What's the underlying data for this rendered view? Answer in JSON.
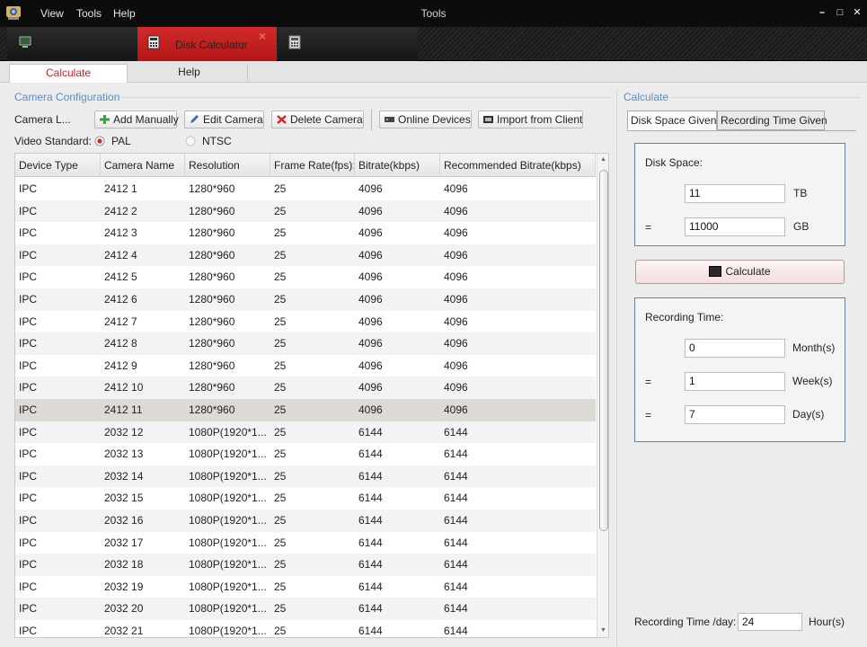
{
  "titlebar": {
    "menus": [
      "View",
      "Tools",
      "Help"
    ],
    "title": "Tools"
  },
  "modules": {
    "control_panel": "Control Panel",
    "disk_calculator": "Disk Calculator",
    "calculation_tool": "Calculation Tool"
  },
  "subtabs": {
    "calculate": "Calculate",
    "help": "Help"
  },
  "camera_config": {
    "title": "Camera Configuration",
    "camera_list_label": "Camera L...",
    "buttons": {
      "add_manually": "Add Manually",
      "edit_camera": "Edit Camera",
      "delete_camera": "Delete Camera",
      "online_devices": "Online Devices",
      "import_from_client": "Import from Client"
    },
    "video_standard_label": "Video Standard:",
    "pal": "PAL",
    "ntsc": "NTSC",
    "selected_standard": "PAL"
  },
  "table": {
    "headers": [
      "Device Type",
      "Camera Name",
      "Resolution",
      "Frame Rate(fps):",
      "Bitrate(kbps)",
      "Recommended Bitrate(kbps)"
    ],
    "selected_index": 10,
    "rows": [
      [
        "IPC",
        "2412 1",
        "1280*960",
        "25",
        "4096",
        "4096"
      ],
      [
        "IPC",
        "2412 2",
        "1280*960",
        "25",
        "4096",
        "4096"
      ],
      [
        "IPC",
        "2412 3",
        "1280*960",
        "25",
        "4096",
        "4096"
      ],
      [
        "IPC",
        "2412 4",
        "1280*960",
        "25",
        "4096",
        "4096"
      ],
      [
        "IPC",
        "2412 5",
        "1280*960",
        "25",
        "4096",
        "4096"
      ],
      [
        "IPC",
        "2412 6",
        "1280*960",
        "25",
        "4096",
        "4096"
      ],
      [
        "IPC",
        "2412 7",
        "1280*960",
        "25",
        "4096",
        "4096"
      ],
      [
        "IPC",
        "2412 8",
        "1280*960",
        "25",
        "4096",
        "4096"
      ],
      [
        "IPC",
        "2412 9",
        "1280*960",
        "25",
        "4096",
        "4096"
      ],
      [
        "IPC",
        "2412 10",
        "1280*960",
        "25",
        "4096",
        "4096"
      ],
      [
        "IPC",
        "2412 11",
        "1280*960",
        "25",
        "4096",
        "4096"
      ],
      [
        "IPC",
        "2032 12",
        "1080P(1920*1...",
        "25",
        "6144",
        "6144"
      ],
      [
        "IPC",
        "2032 13",
        "1080P(1920*1...",
        "25",
        "6144",
        "6144"
      ],
      [
        "IPC",
        "2032 14",
        "1080P(1920*1...",
        "25",
        "6144",
        "6144"
      ],
      [
        "IPC",
        "2032 15",
        "1080P(1920*1...",
        "25",
        "6144",
        "6144"
      ],
      [
        "IPC",
        "2032 16",
        "1080P(1920*1...",
        "25",
        "6144",
        "6144"
      ],
      [
        "IPC",
        "2032 17",
        "1080P(1920*1...",
        "25",
        "6144",
        "6144"
      ],
      [
        "IPC",
        "2032 18",
        "1080P(1920*1...",
        "25",
        "6144",
        "6144"
      ],
      [
        "IPC",
        "2032 19",
        "1080P(1920*1...",
        "25",
        "6144",
        "6144"
      ],
      [
        "IPC",
        "2032 20",
        "1080P(1920*1...",
        "25",
        "6144",
        "6144"
      ],
      [
        "IPC",
        "2032 21",
        "1080P(1920*1...",
        "25",
        "6144",
        "6144"
      ]
    ]
  },
  "calculate_panel": {
    "title": "Calculate",
    "tabs": {
      "disk_space_given": "Disk Space Given",
      "recording_time_given": "Recording Time Given"
    },
    "disk_space": {
      "label": "Disk Space:",
      "tb_value": "11",
      "tb_unit": "TB",
      "equals": "=",
      "gb_value": "11000",
      "gb_unit": "GB"
    },
    "calculate_button": "Calculate",
    "recording_time": {
      "label": "Recording Time:",
      "month_value": "0",
      "month_unit": "Month(s)",
      "week_value": "1",
      "week_unit": "Week(s)",
      "day_value": "7",
      "day_unit": "Day(s)",
      "equals": "="
    },
    "recording_per_day": {
      "label": "Recording Time /day:",
      "value": "24",
      "unit": "Hour(s)"
    }
  },
  "colors": {
    "accent_red": "#d31f1f",
    "section_blue": "#5b8cc8",
    "box_border": "#5f83b8"
  }
}
